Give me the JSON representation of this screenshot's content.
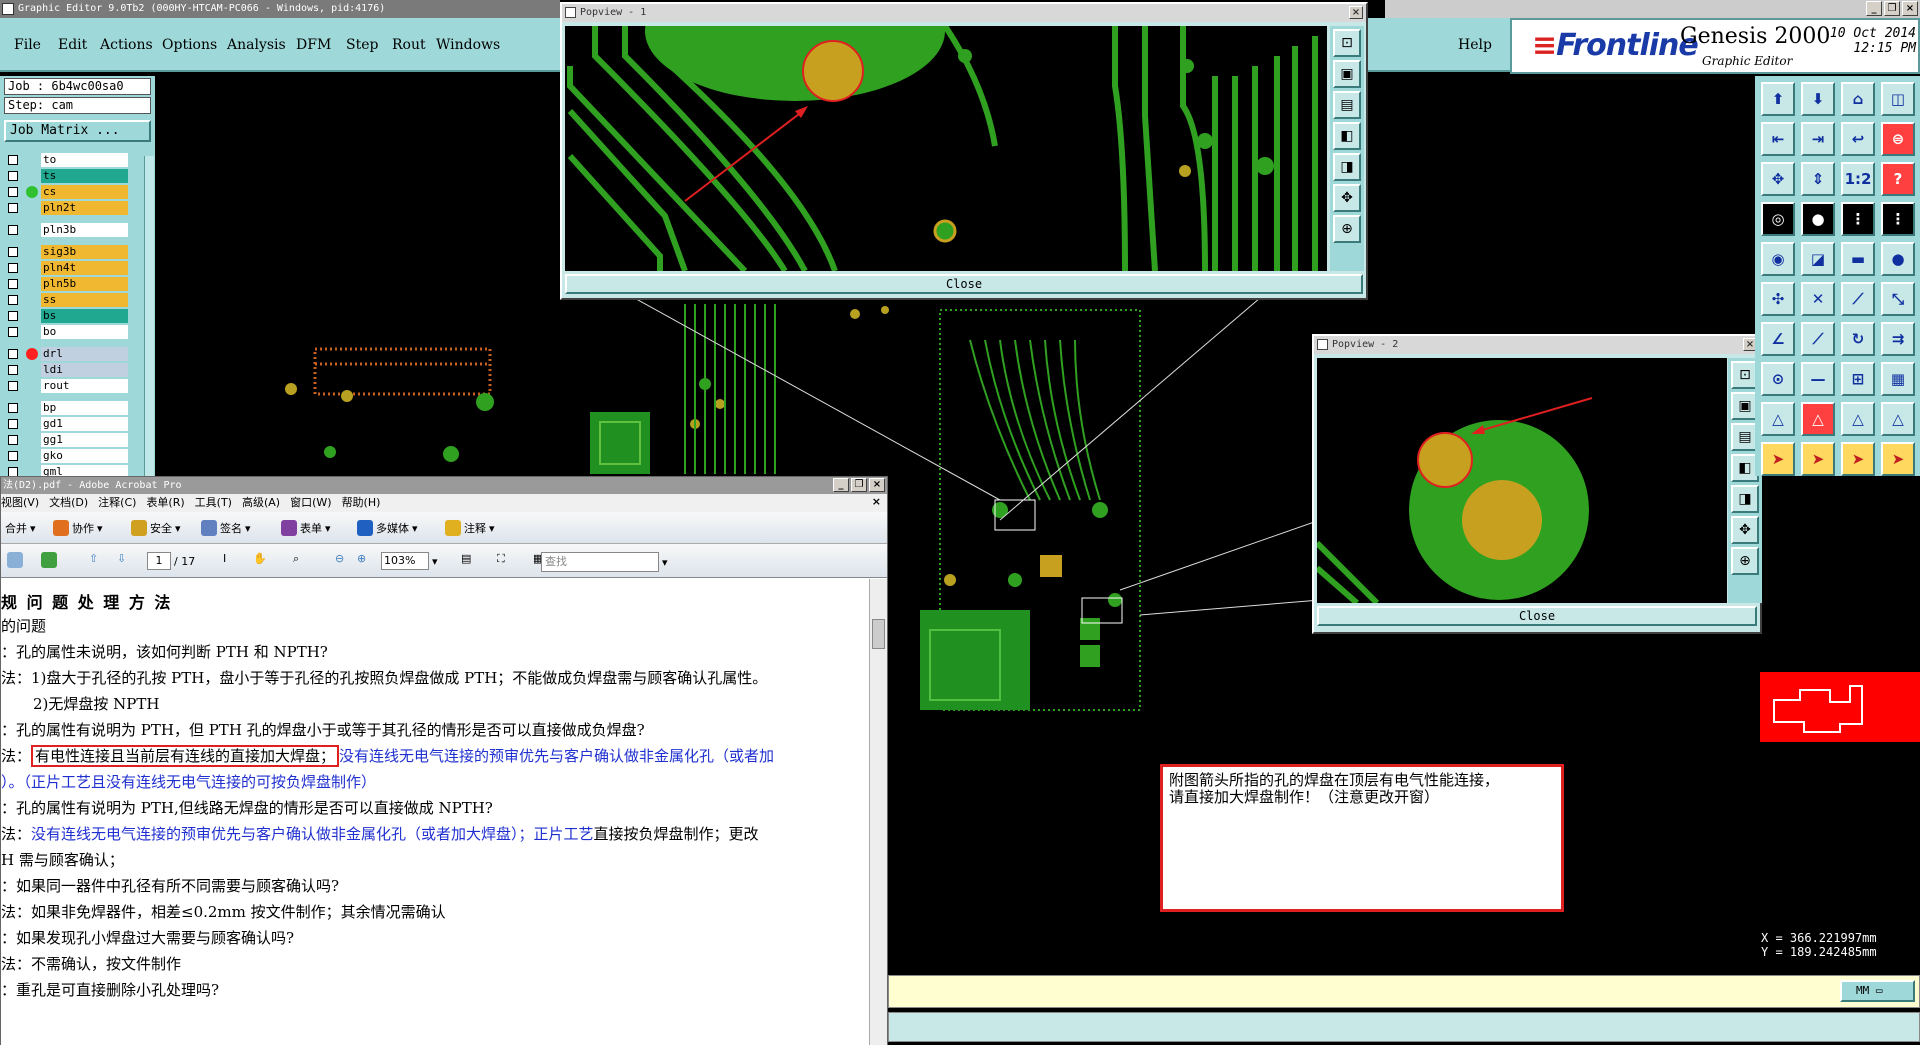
{
  "genesis": {
    "title": "Graphic Editor 9.0Tb2 (000HY-HTCAM-PC066 - Windows, pid:4176)",
    "menu": [
      "File",
      "Edit",
      "Actions",
      "Options",
      "Analysis",
      "DFM",
      "Step",
      "Rout",
      "Windows"
    ],
    "help": "Help",
    "brand": "Frontline",
    "product": "Genesis 2000",
    "subtitle": "Graphic Editor",
    "date": "10 Oct 2014",
    "time": "12:15 PM",
    "job": "Job : 6b4wc00sa0",
    "step": "Step: cam",
    "job_matrix": "Job Matrix ...",
    "layers": [
      {
        "name": "to",
        "color": "#ffffff",
        "dot": ""
      },
      {
        "name": "ts",
        "color": "#20a890",
        "dot": ""
      },
      {
        "name": "cs",
        "color": "#f0b830",
        "dot": "#30c030"
      },
      {
        "name": "pln2t",
        "color": "#f0b830",
        "dot": ""
      },
      {
        "name": "pln3b",
        "color": "#ffffff",
        "dot": ""
      },
      {
        "name": "sig3b",
        "color": "#f0b830",
        "dot": ""
      },
      {
        "name": "pln4t",
        "color": "#f0b830",
        "dot": ""
      },
      {
        "name": "pln5b",
        "color": "#f0b830",
        "dot": ""
      },
      {
        "name": "ss",
        "color": "#f0b830",
        "dot": ""
      },
      {
        "name": "bs",
        "color": "#20a890",
        "dot": ""
      },
      {
        "name": "bo",
        "color": "#ffffff",
        "dot": ""
      },
      {
        "name": "drl",
        "color": "#c0d0e0",
        "dot": "#ff2020"
      },
      {
        "name": "ldi",
        "color": "#c0d0e0",
        "dot": ""
      },
      {
        "name": "rout",
        "color": "#ffffff",
        "dot": ""
      },
      {
        "name": "bp",
        "color": "#ffffff",
        "dot": ""
      },
      {
        "name": "gd1",
        "color": "#ffffff",
        "dot": ""
      },
      {
        "name": "gg1",
        "color": "#ffffff",
        "dot": ""
      },
      {
        "name": "gko",
        "color": "#ffffff",
        "dot": ""
      },
      {
        "name": "gml",
        "color": "#ffffff",
        "dot": ""
      }
    ],
    "popview1": {
      "title": "Popview - 1",
      "close": "Close"
    },
    "popview2": {
      "title": "Popview - 2",
      "close": "Close"
    },
    "coord_x": "X = 366.221997mm",
    "coord_y": "Y = 189.242485mm",
    "units": "MM",
    "note_line1": "附图箭头所指的孔的焊盘在顶层有电气性能连接，",
    "note_line2": "请直接加大焊盘制作！（注意更改开窗）"
  },
  "acrobat": {
    "title": "法(D2).pdf - Adobe Acrobat Pro",
    "menu": [
      "视图(V)",
      "文档(D)",
      "注释(C)",
      "表单(R)",
      "工具(T)",
      "高级(A)",
      "窗口(W)",
      "帮助(H)"
    ],
    "tb1": [
      "合并",
      "协作",
      "安全",
      "签名",
      "表单",
      "多媒体",
      "注释"
    ],
    "page": "1",
    "pages": "/ 17",
    "zoom": "103%",
    "search_placeholder": "查找",
    "lines": [
      "规 问 题 处 理 方 法",
      "的问题",
      "：孔的属性未说明，该如何判断 PTH 和 NPTH?",
      "法：1)盘大于孔径的孔按 PTH，盘小于等于孔径的孔按照负焊盘做成 PTH；不能做成负焊盘需与顾客确认孔属性。",
      "2)无焊盘按 NPTH",
      "：孔的属性有说明为 PTH，但 PTH 孔的焊盘小于或等于其孔径的情形是否可以直接做成负焊盘?",
      "法：",
      "有电性连接且当前层有连线的直接加大焊盘；",
      "没有连线无电气连接的预审优先与客户确认做非金属化孔（或者加",
      "）。（正片工艺且没有连线无电气连接的可按负焊盘制作）",
      "：孔的属性有说明为 PTH,但线路无焊盘的情形是否可以直接做成 NPTH?",
      "法：",
      "没有连线无电气连接的预审优先与客户确认做非金属化孔（或者加大焊盘）；正片工艺",
      "直接按负焊盘制作；更改",
      "H 需与顾客确认；",
      "：如果同一器件中孔径有所不同需要与顾客确认吗?",
      "法：如果非免焊器件，相差≤0.2mm 按文件制作；其余情况需确认",
      "：如果发现孔小焊盘过大需要与顾客确认吗?",
      "法：不需确认，按文件制作",
      "：重孔是可直接删除小孔处理吗?"
    ]
  }
}
